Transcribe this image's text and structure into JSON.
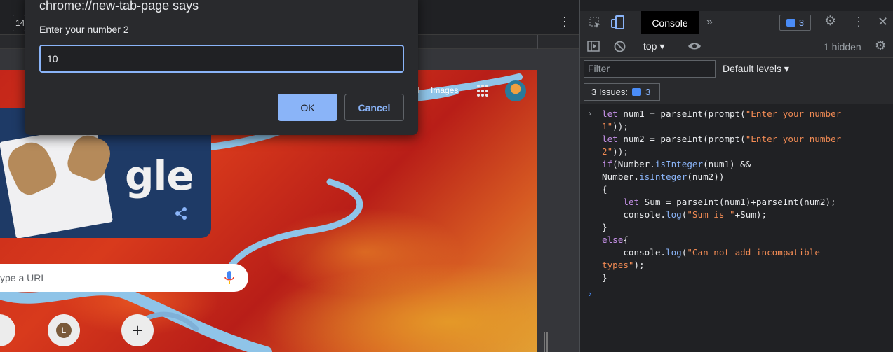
{
  "browser": {
    "dimension_value": "14",
    "ntp": {
      "top_link_gmail": "ail",
      "top_link_images": "Images",
      "doodle_text": "gle",
      "search_placeholder": "ype a URL",
      "shortcut_letter": "L",
      "add_shortcut": "+"
    }
  },
  "dialog": {
    "title": "chrome://new-tab-page says",
    "message": "Enter your number 2",
    "input_value": "10",
    "ok_label": "OK",
    "cancel_label": "Cancel"
  },
  "devtools": {
    "console_tab": "Console",
    "message_count": "3",
    "context": "top",
    "hidden_count": "1 hidden",
    "filter_placeholder": "Filter",
    "levels_label": "Default levels",
    "issues_label": "3 Issues:",
    "issues_count": "3",
    "code_lines": [
      "let num1 = parseInt(prompt(\"Enter your number",
      "1\"));",
      "let num2 = parseInt(prompt(\"Enter your number",
      "2\"));",
      "if(Number.isInteger(num1) &&",
      "Number.isInteger(num2))",
      "{",
      "    let Sum = parseInt(num1)+parseInt(num2);",
      "    console.log(\"Sum is \"+Sum);",
      "}",
      "else{",
      "    console.log(\"Can not add incompatible",
      "types\");",
      "}"
    ]
  },
  "colors": {
    "accent_blue": "#8ab4f8",
    "keyword_purple": "#c792ea",
    "string_orange": "#f28b54",
    "devtools_bg": "#202124"
  },
  "icons": [
    "inspect-icon",
    "device-icon",
    "more-tabs-icon",
    "settings-icon",
    "kebab-icon",
    "close-icon",
    "sidebar-icon",
    "clear-icon",
    "eye-icon",
    "apps-icon",
    "mic-icon",
    "share-icon"
  ]
}
